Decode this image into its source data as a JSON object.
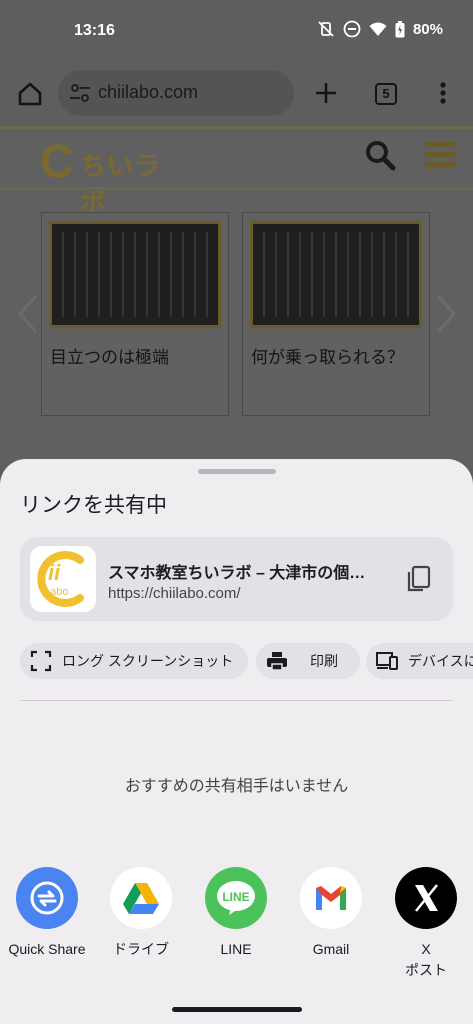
{
  "status": {
    "time": "13:16",
    "battery": "80%"
  },
  "browser": {
    "url": "chiilabo.com",
    "tab_count": "5"
  },
  "site": {
    "logo_mark": "C",
    "logo_text": "ちいラボ",
    "cards": [
      {
        "title": "目立つのは極端"
      },
      {
        "title": "何が乗っ取られる？"
      }
    ]
  },
  "share": {
    "title": "リンクを共有中",
    "link_title": "スマホ教室ちいラボ – 大津市の個…",
    "link_url": "https://chiilabo.com/",
    "favicon_text": "Labo",
    "favicon_letters": "ii",
    "chips": [
      "ロング スクリーンショット",
      "印刷",
      "デバイスに"
    ],
    "empty_message": "おすすめの共有相手はいません",
    "targets": [
      {
        "label": "Quick Share"
      },
      {
        "label": "ドライブ"
      },
      {
        "label": "LINE"
      },
      {
        "label": "Gmail"
      },
      {
        "label": "X",
        "sublabel": "ポスト"
      }
    ],
    "colors": {
      "quick_share": "#4a84f0",
      "line": "#4cc25a",
      "x": "#000000",
      "accent_gold": "#f0c030"
    }
  }
}
